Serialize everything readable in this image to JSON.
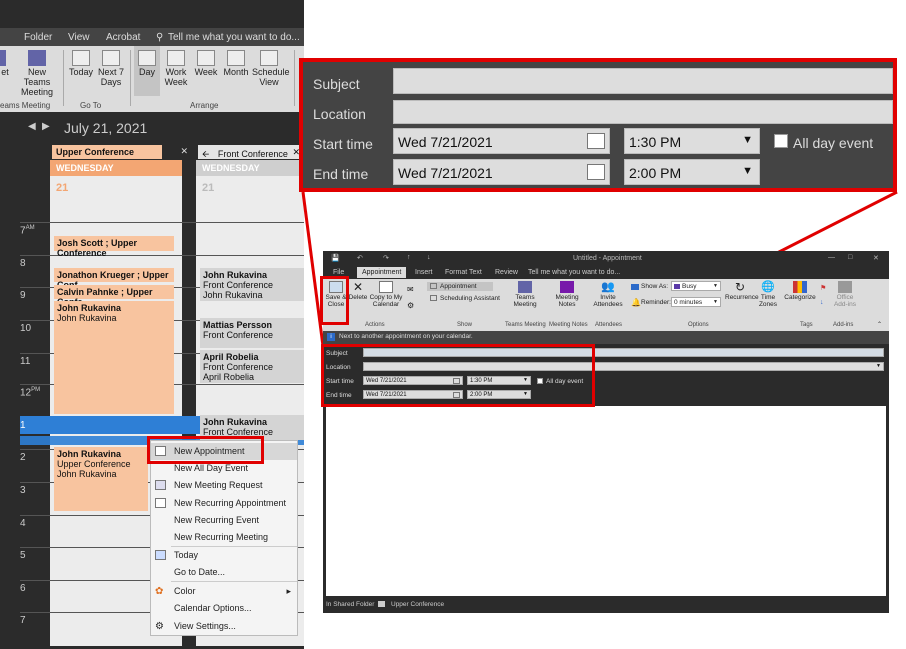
{
  "left": {
    "menu": [
      "Folder",
      "View",
      "Acrobat"
    ],
    "tell_me": "Tell me what you want to do...",
    "ribbon": {
      "teams_truncated": "et",
      "new_teams_meeting": "New Teams Meeting",
      "today": "Today",
      "next7": "Next 7 Days",
      "day": "Day",
      "work_week": "Work Week",
      "week": "Week",
      "month": "Month",
      "schedule_view": "Schedule View",
      "groups": [
        "eams Meeting",
        "Go To",
        "Arrange"
      ]
    },
    "date_title": "July 21, 2021",
    "calendars": [
      {
        "name": "Upper Conference",
        "weekday": "WEDNESDAY",
        "day": "21"
      },
      {
        "name": "Front Conference",
        "weekday": "WEDNESDAY",
        "day": "21"
      }
    ],
    "hours": [
      "7 AM",
      "8",
      "9",
      "10",
      "11",
      "12 PM",
      "1",
      "2",
      "3",
      "4",
      "5",
      "6",
      "7"
    ],
    "hours_am": "AM",
    "hours_pm": "PM",
    "upper_appts": [
      {
        "title": "Josh Scott ; Upper Conference"
      },
      {
        "title": "Jonathon Krueger ; Upper Conf"
      },
      {
        "title": "Calvin Pahnke ; Upper Confe"
      },
      {
        "title": "John Rukavina",
        "line2": "John Rukavina"
      },
      {
        "title": "John Rukavina",
        "line2": "Upper Conference",
        "line3": "John Rukavina"
      }
    ],
    "front_appts": [
      {
        "title": "John Rukavina",
        "line2": "Front Conference",
        "line3": "John Rukavina"
      },
      {
        "title": "Mattias Persson",
        "line2": "Front Conference"
      },
      {
        "title": "April Robelia",
        "line2": "Front Conference",
        "line3": "April Robelia"
      },
      {
        "title": "John Rukavina",
        "line2": "Front Conference"
      }
    ],
    "context_menu": [
      "New Appointment",
      "New All Day Event",
      "New Meeting Request",
      "New Recurring Appointment",
      "New Recurring Event",
      "New Recurring Meeting",
      "Today",
      "Go to Date...",
      "Color",
      "Calendar Options...",
      "View Settings..."
    ]
  },
  "zoom": {
    "subject_label": "Subject",
    "location_label": "Location",
    "start_label": "Start time",
    "end_label": "End time",
    "start_date": "Wed 7/21/2021",
    "start_time": "1:30 PM",
    "end_date": "Wed 7/21/2021",
    "end_time": "2:00 PM",
    "all_day": "All day event"
  },
  "appt_window": {
    "title": "Untitled - Appointment",
    "tabs": [
      "File",
      "Appointment",
      "Insert",
      "Format Text",
      "Review"
    ],
    "tell_me": "Tell me what you want to do...",
    "buttons": {
      "save_close": "Save & Close",
      "delete": "Delete",
      "copy_calendar": "Copy to My Calendar",
      "appointment": "Appointment",
      "scheduling": "Scheduling Assistant",
      "teams": "Teams Meeting",
      "meeting_notes": "Meeting Notes",
      "invite": "Invite Attendees",
      "show_as_label": "Show As:",
      "show_as_value": "Busy",
      "reminder_label": "Reminder:",
      "reminder_value": "0 minutes",
      "recurrence": "Recurrence",
      "time_zones": "Time Zones",
      "categorize": "Categorize",
      "office_addins": "Office Add-ins"
    },
    "groups": [
      "Actions",
      "Show",
      "Teams Meeting",
      "Meeting Notes",
      "Attendees",
      "Options",
      "Tags",
      "Add-ins"
    ],
    "info": "Next to another appointment on your calendar.",
    "subject_label": "Subject",
    "location_label": "Location",
    "start_label": "Start time",
    "end_label": "End time",
    "start_date": "Wed 7/21/2021",
    "start_time": "1:30 PM",
    "end_date": "Wed 7/21/2021",
    "end_time": "2:00 PM",
    "all_day": "All day event",
    "status": "In Shared Folder",
    "status_folder": "Upper Conference"
  },
  "colors": {
    "highlight": "#e00000",
    "appt": "#f8c49f",
    "weekday": "#f3a673"
  }
}
